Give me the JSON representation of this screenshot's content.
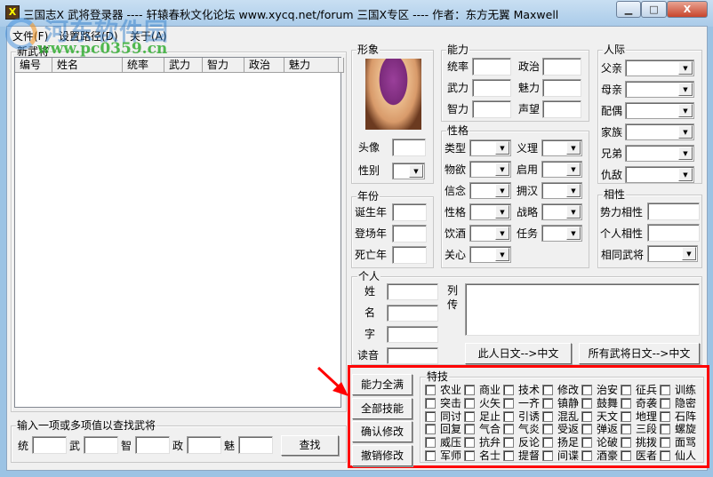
{
  "window": {
    "title": "三国志X 武将登录器 ---- 轩辕春秋文化论坛 www.xycq.net/forum 三国X专区 ---- 作者：东方无翼 Maxwell",
    "icon": "X",
    "minimize": "▁",
    "maximize": "□",
    "close": "X"
  },
  "menu": [
    "文件(F)",
    "设置路径(D)",
    "关于(A)"
  ],
  "watermark": {
    "name": "河东软件园",
    "url": "www.pc0359.cn"
  },
  "list": {
    "group": "新武将",
    "columns": [
      "编号",
      "姓名",
      "统率",
      "武力",
      "智力",
      "政治",
      "魅力"
    ]
  },
  "search": {
    "group": "输入一项或多项值以查找武将",
    "fields": [
      "统",
      "武",
      "智",
      "政",
      "魅"
    ],
    "button": "查找"
  },
  "image": {
    "group": "形象",
    "portrait_label": "头像",
    "gender_label": "性别"
  },
  "years": {
    "group": "年份",
    "fields": [
      "诞生年",
      "登场年",
      "死亡年"
    ]
  },
  "ability": {
    "group": "能力",
    "left": [
      "统率",
      "武力",
      "智力"
    ],
    "right": [
      "政治",
      "魅力",
      "声望"
    ]
  },
  "personality": {
    "group": "性格",
    "left": [
      "类型",
      "物欲",
      "信念",
      "性格",
      "饮酒",
      "关心"
    ],
    "right": [
      "义理",
      "启用",
      "拥汉",
      "战略",
      "任务"
    ]
  },
  "relations": {
    "group": "人际",
    "fields": [
      "父亲",
      "母亲",
      "配偶",
      "家族",
      "兄弟",
      "仇敌"
    ]
  },
  "affinity": {
    "group": "相性",
    "fields": [
      "势力相性",
      "个人相性"
    ],
    "combo": "相同武将"
  },
  "personal": {
    "group": "个人",
    "fields": [
      "姓",
      "名",
      "字",
      "读音"
    ],
    "bio_label1": "列",
    "bio_label2": "传",
    "btn_this": "此人日文-->中文",
    "btn_all": "所有武将日文-->中文"
  },
  "actions": [
    "能力全满",
    "全部技能",
    "确认修改",
    "撤销修改"
  ],
  "skills": {
    "group": "特技",
    "items": [
      "农业",
      "商业",
      "技术",
      "修改",
      "治安",
      "征兵",
      "训练",
      "突击",
      "火矢",
      "一齐",
      "镇静",
      "鼓舞",
      "奇袭",
      "隐密",
      "同讨",
      "足止",
      "引诱",
      "混乱",
      "天文",
      "地理",
      "石阵",
      "回复",
      "气合",
      "气炎",
      "受返",
      "弹返",
      "三段",
      "螺旋",
      "威压",
      "抗弁",
      "反论",
      "扬足",
      "论破",
      "挑拨",
      "面骂",
      "军师",
      "名士",
      "提督",
      "间谍",
      "酒豪",
      "医者",
      "仙人"
    ]
  },
  "highlight_color": "#ff0000"
}
